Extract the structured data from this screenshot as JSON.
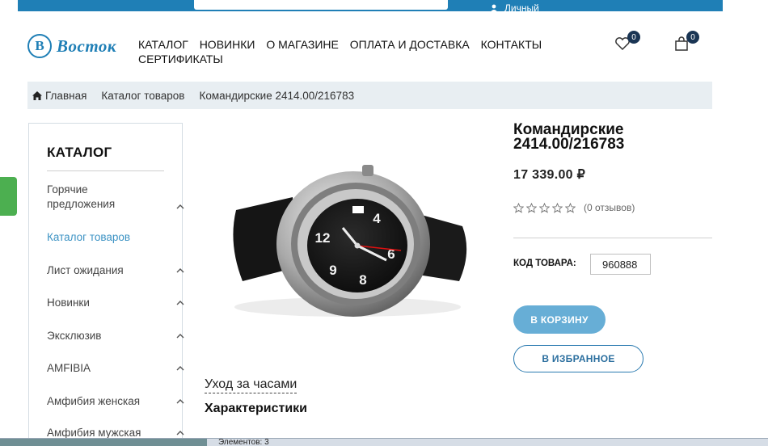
{
  "header": {
    "account_label": "Личный",
    "logo_text": "Восток",
    "nav": [
      "КАТАЛОГ",
      "НОВИНКИ",
      "О МАГАЗИНЕ",
      "ОПЛАТА И ДОСТАВКА",
      "КОНТАКТЫ",
      "СЕРТИФИКАТЫ"
    ],
    "wishlist_count": "0",
    "cart_count": "0"
  },
  "breadcrumb": [
    "Главная",
    "Каталог товаров",
    "Командирские 2414.00/216783"
  ],
  "sidebar": {
    "title": "КАТАЛОГ",
    "items": [
      {
        "label": "Горячие предложения",
        "expandable": true,
        "active": false
      },
      {
        "label": "Каталог товаров",
        "expandable": false,
        "active": true
      },
      {
        "label": "Лист ожидания",
        "expandable": true,
        "active": false
      },
      {
        "label": "Новинки",
        "expandable": true,
        "active": false
      },
      {
        "label": "Эксклюзив",
        "expandable": true,
        "active": false
      },
      {
        "label": "AMFIBIA",
        "expandable": true,
        "active": false
      },
      {
        "label": "Амфибия женская",
        "expandable": true,
        "active": false
      },
      {
        "label": "Амфибия мужская",
        "expandable": true,
        "active": false
      }
    ]
  },
  "product": {
    "title": "Командирские 2414.00/216783",
    "price": "17 339.00 ₽",
    "rating": 0,
    "reviews": "(0 отзывов)",
    "sku_label": "КОД ТОВАРА:",
    "sku": "960888",
    "add_to_cart": "В КОРЗИНУ",
    "add_to_favorites": "В ИЗБРАННОЕ",
    "care_link": "Уход за часами",
    "specs_title": "Характеристики"
  },
  "taskbar": {
    "label": "Элементов: 3"
  },
  "colors": {
    "brand": "#1f7fb6",
    "button": "#67aed6",
    "badge": "#1a3554",
    "breadcrumb_bg": "#e8eef2"
  }
}
